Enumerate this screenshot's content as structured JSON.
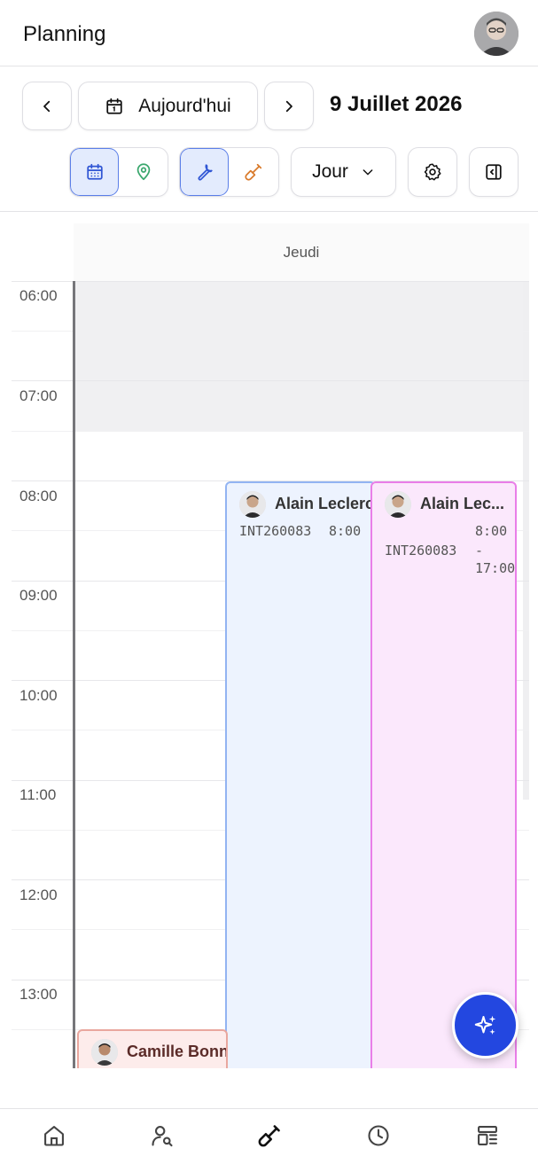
{
  "header": {
    "title": "Planning",
    "avatar": "user-avatar"
  },
  "toolbar": {
    "prev_icon": "chevron-left-icon",
    "today_icon": "calendar-icon",
    "today_label": "Aujourd'hui",
    "next_icon": "chevron-right-icon",
    "current_date": "9 Juillet 2026",
    "view_toggle": [
      {
        "icon": "calendar-grid-icon",
        "active": true
      },
      {
        "icon": "map-pin-icon",
        "active": false
      }
    ],
    "type_toggle": [
      {
        "icon": "wrench-icon",
        "active": true
      },
      {
        "icon": "shovel-icon",
        "active": false
      }
    ],
    "view_select": "Jour",
    "settings_icon": "gear-icon",
    "panel_icon": "sidebar-toggle-icon"
  },
  "calendar": {
    "day_label": "Jeudi",
    "hours": [
      "06:00",
      "07:00",
      "08:00",
      "09:00",
      "10:00",
      "11:00",
      "12:00",
      "13:00"
    ],
    "events": [
      {
        "name": "Alain Leclerc",
        "code": "INT260083",
        "time": "8:00 -",
        "color": "#92b4f2"
      },
      {
        "name": "Alain Lec...",
        "code": "INT260083",
        "time_start": "8:00",
        "time_dash": "-",
        "time_end": "17:00",
        "color": "#e97ee8"
      },
      {
        "name": "Camille Bonn",
        "color": "#e9a79e"
      }
    ]
  },
  "fab": {
    "icon": "sparkles-icon",
    "color": "#2347e0"
  },
  "bottom_nav": [
    {
      "icon": "home-icon"
    },
    {
      "icon": "user-search-icon"
    },
    {
      "icon": "shovel-icon"
    },
    {
      "icon": "clock-icon"
    },
    {
      "icon": "layout-icon"
    }
  ]
}
